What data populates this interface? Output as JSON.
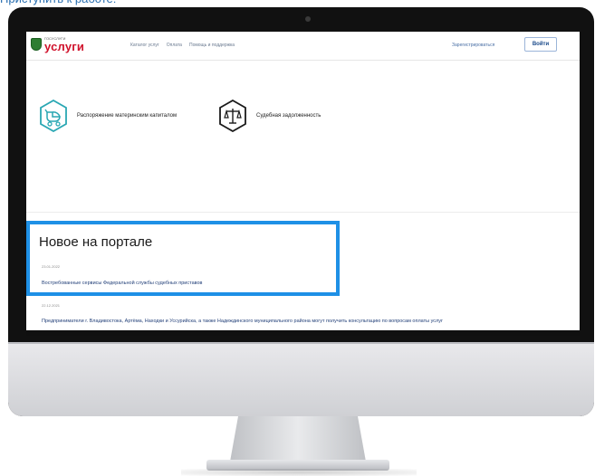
{
  "caption": {
    "top_text": "Приступить к работе:"
  },
  "header": {
    "logo_small": "ГОСУСЛУГИ",
    "logo_main": "услуги",
    "nav": [
      "Каталог услуг",
      "Оплата",
      "Помощь и поддержка"
    ],
    "register_link": "Зарегистрироваться",
    "login_button": "Войти"
  },
  "services": [
    {
      "label": "Распоряжение материнским капиталом",
      "icon": "baby-stroller-icon"
    },
    {
      "label": "Судебная задолженность",
      "icon": "scales-icon"
    }
  ],
  "news": {
    "heading": "Новое на портале",
    "items": [
      {
        "date": "23.01.2022",
        "text": "Востребованные сервисы Федеральной службы судебных приставов"
      },
      {
        "date": "22.12.2021",
        "text": "Предприниматели г. Владивостока, Артёма, Находки и Уссурийска, а также Надеждинского муниципального района могут получить консультацию по вопросам оплаты услуг"
      }
    ]
  },
  "colors": {
    "highlight": "#1e90e6",
    "logo_red": "#d0112b",
    "link_blue": "#25427a",
    "icon_teal": "#29a7b3"
  }
}
